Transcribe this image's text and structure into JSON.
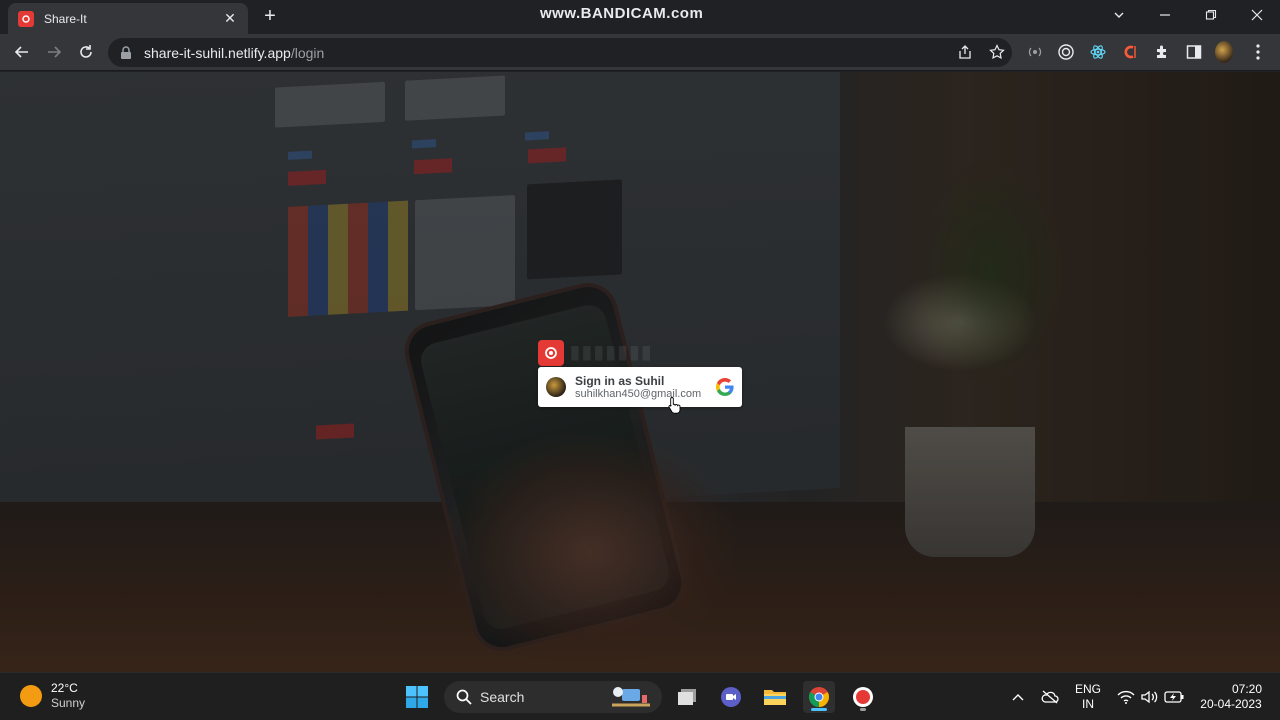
{
  "browser": {
    "tab_title": "Share-It",
    "tab_close": "✕",
    "new_tab": "+",
    "watermark": "www.BANDICAM.com",
    "url_host": "share-it-suhil.netlify.app",
    "url_path": "/login"
  },
  "page": {
    "signin": {
      "title": "Sign in as Suhil",
      "email": "suhilkhan450@gmail.com"
    },
    "accent_color": "#e53935"
  },
  "taskbar": {
    "weather_temp": "22°C",
    "weather_condition": "Sunny",
    "search_label": "Search",
    "lang_top": "ENG",
    "lang_bottom": "IN",
    "time": "07:20",
    "date": "20-04-2023"
  }
}
